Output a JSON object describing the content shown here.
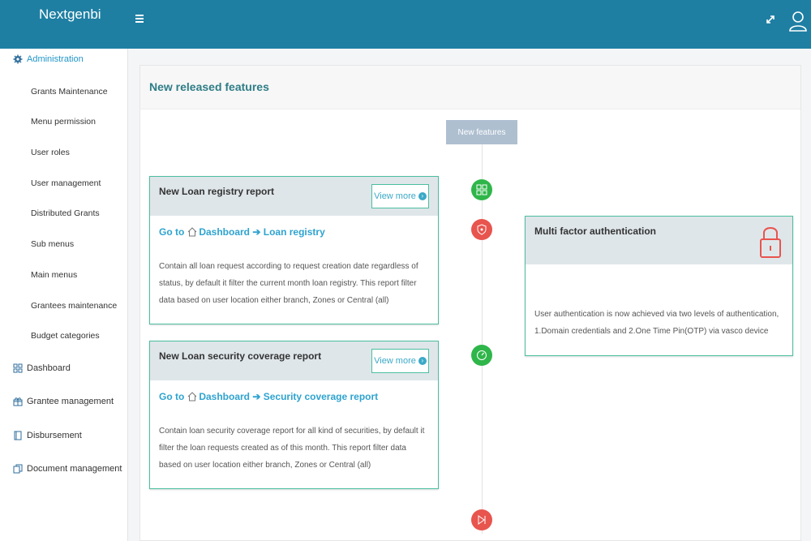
{
  "app": {
    "title": "Nextgenbi"
  },
  "sidebar": {
    "admin": "Administration",
    "admin_items": [
      "Grants Maintenance",
      "Menu permission",
      "User roles",
      "User management",
      "Distributed Grants",
      "Sub menus",
      "Main menus",
      "Grantees maintenance",
      "Budget categories"
    ],
    "dashboard": "Dashboard",
    "grantee": "Grantee management",
    "disbursement": "Disbursement",
    "document": "Document management"
  },
  "panel": {
    "title": "New released features",
    "badge": "New features"
  },
  "cards": [
    {
      "title": "New Loan registry report",
      "view_more": "View more",
      "goto": "Go to",
      "crumb1": "Dashboard",
      "crumb2": "Loan registry",
      "desc": "Contain all loan request according to request creation date regardless of status, by default it filter the current month loan registry. This report filter data based on user location either branch, Zones or Central (all)"
    },
    {
      "title": "New Loan security coverage report",
      "view_more": "View more",
      "goto": "Go to",
      "crumb1": "Dashboard",
      "crumb2": "Security coverage report",
      "desc": "Contain loan security coverage report for all kind of securities, by default it filter the loan requests created as of this month. This report filter data based on user location either branch, Zones or Central (all)"
    },
    {
      "title": "Multi factor authentication",
      "desc": "User authentication is now achieved via two levels of authentication, 1.Domain credentials and 2.One Time Pin(OTP) via vasco device"
    }
  ],
  "colors": {
    "topbar": "#1e7fa3",
    "accent": "#2ea3cf",
    "card_border": "#4bbfa0",
    "green": "#2fb64a",
    "red": "#e8544e"
  }
}
